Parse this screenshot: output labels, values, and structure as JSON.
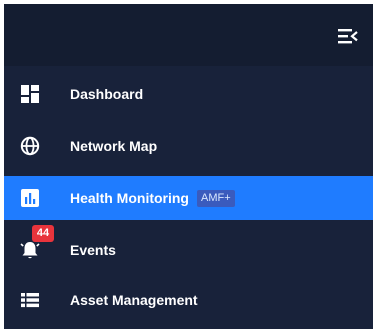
{
  "sidebar": {
    "colors": {
      "background": "#18223a",
      "topbar": "#141d31",
      "active": "#1f7cff",
      "badge": "#e8343c",
      "tag": "#3a5bbd"
    },
    "collapse_icon": "menu-collapse-icon",
    "items": [
      {
        "label": "Dashboard",
        "icon": "dashboard-icon",
        "active": false
      },
      {
        "label": "Network Map",
        "icon": "globe-icon",
        "active": false
      },
      {
        "label": "Health Monitoring",
        "icon": "chart-icon",
        "active": true,
        "tag": "AMF+"
      },
      {
        "label": "Events",
        "icon": "bell-icon",
        "active": false,
        "badge": "44"
      },
      {
        "label": "Asset Management",
        "icon": "list-icon",
        "active": false
      }
    ]
  }
}
